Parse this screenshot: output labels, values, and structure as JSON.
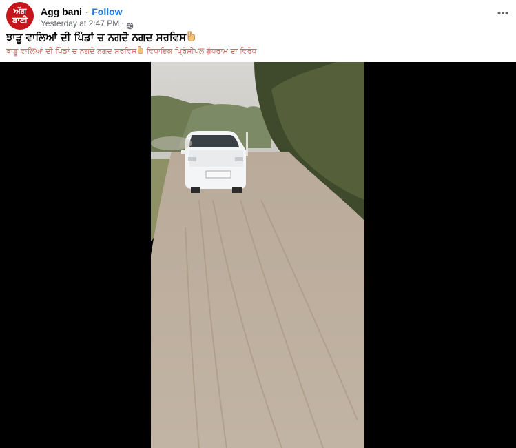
{
  "post": {
    "author": "Agg bani",
    "separator": "·",
    "follow_label": "Follow",
    "timestamp": "Yesterday at 2:47 PM",
    "meta_dot": "·",
    "privacy_icon": "globe-icon",
    "more_icon": "more-options-icon",
    "avatar": {
      "line1": "ਅੱਗ",
      "line2": "ਬਾਣੀ",
      "color": "#c8141b"
    },
    "title": "ਝਾੜੂ ਵਾਲਿਆਂ ਦੀ ਪਿੰਡਾਂ ਚ ਨਗਦੋ ਨਗਦ ਸਰਵਿਸ",
    "subtitle": "ਝਾੜੂ ਵਾਲਿਆਂ ਦੀ ਪਿੰਡਾਂ ਚ ਨਗਦੋ ਨਗਦ ਸਰਵਿਸ",
    "subtitle_rest": " ਵਿਧਾਇਕ ਪ੍ਰਿੰਸੀਪਲ ਬੁੱਧਰਾਮ ਦਾ ਵਿਰੋਧ",
    "emoji_icon": "pointing-hand-icon"
  },
  "colors": {
    "link": "#1877f2",
    "secondary_text": "#65676b",
    "subtitle_text": "#d36a5d",
    "video_background": "#000000"
  }
}
